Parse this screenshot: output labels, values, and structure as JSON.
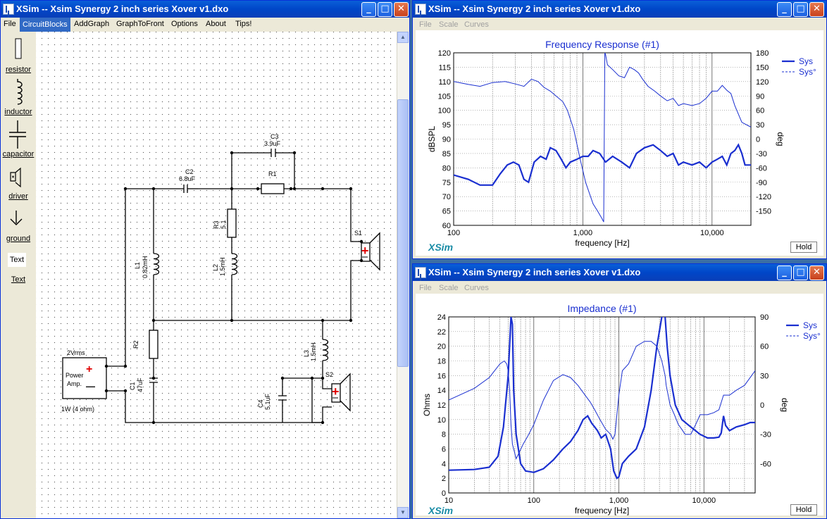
{
  "main_window": {
    "title": "XSim -- Xsim Synergy 2 inch series Xover v1.dxo",
    "menu": [
      "File",
      "CircuitBlocks",
      "AddGraph",
      "GraphToFront",
      "Options",
      "About",
      "Tips!"
    ],
    "palette": [
      {
        "label": "resistor",
        "icon": "resistor-icon"
      },
      {
        "label": "inductor",
        "icon": "inductor-icon"
      },
      {
        "label": "capacitor",
        "icon": "capacitor-icon"
      },
      {
        "label": "driver",
        "icon": "driver-icon"
      },
      {
        "label": "ground",
        "icon": "ground-icon"
      },
      {
        "label": "Text",
        "icon": "text-icon",
        "preview": "Text"
      }
    ]
  },
  "schematic": {
    "components": {
      "c3": {
        "name": "C3",
        "value": "3.9uF"
      },
      "c2": {
        "name": "C2",
        "value": "6.8uF"
      },
      "r1": {
        "name": "R1"
      },
      "r3": {
        "name": "R3",
        "value": "5.1"
      },
      "l1": {
        "name": "L1",
        "value": "0.82mH"
      },
      "l2": {
        "name": "L2",
        "value": "1.5mH"
      },
      "s1": {
        "name": "S1"
      },
      "r2": {
        "name": "R2"
      },
      "l3": {
        "name": "L3",
        "value": "1.5mH"
      },
      "s2": {
        "name": "S2"
      },
      "c1": {
        "name": "C1",
        "value": "47uF"
      },
      "c4": {
        "name": "C4",
        "value": "5.1uF"
      }
    },
    "amp": {
      "voltage": "2Vrms",
      "line1": "Power",
      "line2": "Amp.",
      "plus": "+",
      "minus": "—",
      "power": "1W (4 ohm)"
    }
  },
  "fr_window": {
    "title": "XSim -- Xsim Synergy 2 inch series Xover v1.dxo",
    "menu": [
      "File",
      "Scale",
      "Curves"
    ],
    "brand": "XSim",
    "hold_label": "Hold",
    "colors": {
      "trace": "#1a2fd0",
      "grid": "#888888"
    }
  },
  "imp_window": {
    "title": "XSim -- Xsim Synergy 2 inch series Xover v1.dxo",
    "menu": [
      "File",
      "Scale",
      "Curves"
    ],
    "brand": "XSim",
    "hold_label": "Hold"
  },
  "chart_data": [
    {
      "type": "line",
      "title": "Frequency Response (#1)",
      "xlabel": "frequency [Hz]",
      "ylabel": "dBSPL",
      "y2label": "deg",
      "xscale": "log",
      "xlim": [
        100,
        20000
      ],
      "ylim": [
        60,
        120
      ],
      "y2lim": [
        -180,
        180
      ],
      "xticks": [
        "100",
        "1,000",
        "10,000"
      ],
      "yticks": [
        60,
        65,
        70,
        75,
        80,
        85,
        90,
        95,
        100,
        105,
        110,
        115,
        120
      ],
      "y2ticks": [
        180,
        150,
        120,
        90,
        60,
        30,
        0,
        -30,
        -60,
        -90,
        -120,
        -150
      ],
      "legend": "top-right",
      "grid": true,
      "series": [
        {
          "name": "Sys",
          "style": "solid",
          "axis": "left",
          "x": [
            100,
            130,
            160,
            200,
            230,
            260,
            290,
            320,
            350,
            380,
            420,
            470,
            520,
            560,
            620,
            680,
            740,
            800,
            900,
            1000,
            1100,
            1200,
            1350,
            1500,
            1700,
            2000,
            2300,
            2600,
            3000,
            3500,
            4000,
            4500,
            5000,
            5500,
            6000,
            7000,
            8000,
            9000,
            10000,
            11000,
            12000,
            13000,
            14000,
            15000,
            16000,
            17000,
            18000,
            20000
          ],
          "y": [
            77.5,
            76,
            74,
            74,
            78,
            81,
            82,
            81,
            76,
            75,
            82,
            84,
            83,
            87,
            86,
            83,
            80,
            82,
            83,
            84,
            84,
            86,
            85,
            82,
            84,
            82,
            80,
            85,
            87,
            88,
            86,
            84,
            85,
            81,
            82,
            81,
            82,
            80,
            82,
            83,
            84,
            81,
            85,
            86,
            88,
            85,
            81,
            81
          ]
        },
        {
          "name": "Sys°",
          "style": "dashed",
          "axis": "right",
          "x": [
            100,
            130,
            160,
            200,
            250,
            300,
            350,
            400,
            450,
            500,
            560,
            620,
            700,
            760,
            850,
            950,
            1050,
            1200,
            1300,
            1400,
            1450,
            1480,
            1500,
            1550,
            1700,
            1900,
            2100,
            2300,
            2500,
            2700,
            2900,
            3200,
            3600,
            4000,
            4500,
            5000,
            5500,
            6000,
            7000,
            8000,
            9000,
            10000,
            11000,
            12000,
            13000,
            14000,
            15000,
            17000,
            20000
          ],
          "y": [
            120,
            114,
            110,
            118,
            120,
            115,
            110,
            125,
            120,
            108,
            100,
            90,
            78,
            60,
            20,
            -40,
            -90,
            -135,
            -150,
            -165,
            -173,
            180,
            176,
            155,
            145,
            132,
            128,
            150,
            145,
            138,
            125,
            110,
            100,
            90,
            80,
            85,
            70,
            74,
            70,
            74,
            85,
            100,
            100,
            112,
            102,
            95,
            70,
            35,
            25
          ]
        }
      ]
    },
    {
      "type": "line",
      "title": "Impedance (#1)",
      "xlabel": "frequency [Hz]",
      "ylabel": "Ohms",
      "y2label": "deg",
      "xscale": "log",
      "xlim": [
        10,
        40000
      ],
      "ylim": [
        0,
        24
      ],
      "y2lim": [
        -90,
        90
      ],
      "xticks": [
        "10",
        "100",
        "1,000",
        "10,000"
      ],
      "yticks": [
        0,
        2,
        4,
        6,
        8,
        10,
        12,
        14,
        16,
        18,
        20,
        22,
        24
      ],
      "y2ticks": [
        90,
        60,
        30,
        0,
        -30,
        -60
      ],
      "legend": "top-right",
      "grid": true,
      "series": [
        {
          "name": "Sys",
          "style": "solid",
          "axis": "left",
          "x": [
            10,
            20,
            30,
            38,
            44,
            50,
            54,
            56,
            58,
            62,
            70,
            80,
            100,
            130,
            170,
            220,
            270,
            330,
            380,
            430,
            480,
            520,
            560,
            620,
            700,
            800,
            870,
            950,
            1000,
            1100,
            1300,
            1600,
            2000,
            2400,
            2800,
            3200,
            3400,
            3500,
            3700,
            4000,
            4600,
            5500,
            7000,
            9000,
            11000,
            13000,
            15000,
            16000,
            17000,
            18000,
            20000,
            24000,
            30000,
            35000,
            40000
          ],
          "y": [
            3.1,
            3.2,
            3.5,
            5,
            9,
            16,
            24,
            23,
            14,
            8,
            4,
            3,
            2.8,
            3.3,
            4.5,
            6,
            7,
            8.5,
            10,
            10.5,
            9.5,
            9,
            8.5,
            7.5,
            8,
            6,
            3,
            2,
            2.2,
            4,
            5,
            6,
            9,
            14,
            20,
            24,
            25,
            24,
            20,
            16,
            12,
            10,
            9,
            8,
            7.5,
            7.5,
            7.6,
            8.2,
            10.5,
            9.2,
            8.5,
            9,
            9.3,
            9.6,
            9.6
          ]
        },
        {
          "name": "Sys°",
          "style": "dashed",
          "axis": "right",
          "x": [
            10,
            20,
            30,
            40,
            45,
            48,
            50,
            52,
            54,
            56,
            58,
            62,
            68,
            75,
            85,
            100,
            130,
            170,
            220,
            270,
            330,
            400,
            460,
            520,
            600,
            700,
            800,
            850,
            900,
            1000,
            1100,
            1300,
            1600,
            2000,
            2400,
            2800,
            3200,
            3500,
            3600,
            3800,
            4000,
            4500,
            5000,
            5500,
            6000,
            7000,
            8000,
            9000,
            11000,
            13000,
            15000,
            17000,
            20000,
            24000,
            30000,
            40000
          ],
          "y": [
            5,
            17,
            28,
            42,
            45,
            42,
            35,
            15,
            -20,
            -40,
            -45,
            -55,
            -48,
            -40,
            -32,
            -20,
            5,
            25,
            31,
            28,
            20,
            10,
            3,
            -5,
            -15,
            -25,
            -30,
            -35,
            -30,
            10,
            35,
            42,
            60,
            65,
            65,
            60,
            45,
            30,
            20,
            10,
            0,
            -10,
            -20,
            -25,
            -30,
            -30,
            -20,
            -10,
            -10,
            -8,
            -5,
            10,
            10,
            15,
            20,
            35
          ]
        }
      ]
    }
  ]
}
